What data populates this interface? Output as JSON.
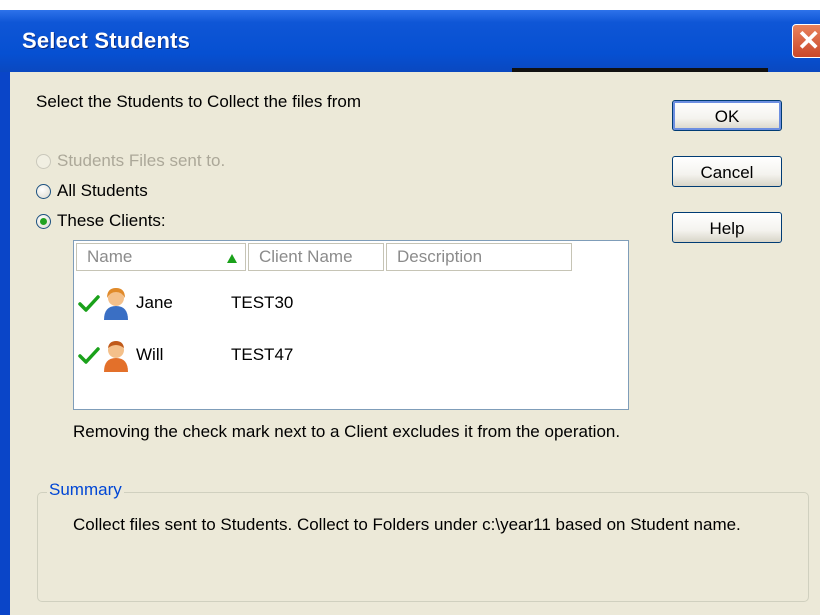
{
  "window": {
    "title": "Select Students",
    "close_icon": "close-icon"
  },
  "dialog": {
    "prompt": "Select the Students to Collect the files from",
    "options": [
      {
        "label": "Students Files sent to.",
        "disabled": true,
        "selected": false
      },
      {
        "label": "All Students",
        "disabled": false,
        "selected": false
      },
      {
        "label": "These Clients:",
        "disabled": false,
        "selected": true
      }
    ],
    "list": {
      "columns": [
        "Name",
        "Client Name",
        "Description"
      ],
      "sort_column": "Name",
      "rows": [
        {
          "checked": true,
          "icon": "female-user-icon",
          "name": "Jane",
          "client": "TEST30",
          "description": ""
        },
        {
          "checked": true,
          "icon": "male-user-icon",
          "name": "Will",
          "client": "TEST47",
          "description": ""
        }
      ]
    },
    "note": "Removing the check mark next to a Client excludes it from the operation.",
    "summary": {
      "label": "Summary",
      "text": "Collect files sent to Students. Collect to Folders under c:\\year11 based on Student name."
    },
    "buttons": {
      "ok": "OK",
      "cancel": "Cancel",
      "help": "Help"
    }
  },
  "colors": {
    "titlebar": "#0650d2",
    "dialog_bg": "#ece9d8",
    "summary_label": "#0046d5",
    "check": "#1aa11a"
  }
}
